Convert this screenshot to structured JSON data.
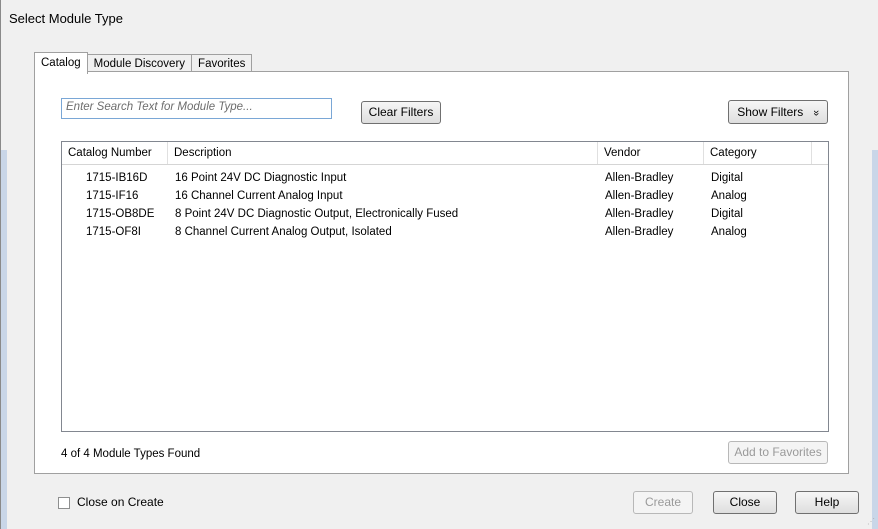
{
  "window": {
    "title": "Select Module Type"
  },
  "tabs": [
    {
      "label": "Catalog",
      "active": true
    },
    {
      "label": "Module Discovery",
      "active": false
    },
    {
      "label": "Favorites",
      "active": false
    }
  ],
  "search": {
    "placeholder": "Enter Search Text for Module Type..."
  },
  "buttons": {
    "clear_filters": "Clear Filters",
    "show_filters": "Show Filters",
    "show_filters_icon": "»",
    "add_to_favorites": "Add to Favorites",
    "create": "Create",
    "close": "Close",
    "help": "Help"
  },
  "table": {
    "columns": [
      "Catalog Number",
      "Description",
      "Vendor",
      "Category"
    ],
    "rows": [
      [
        "1715-IB16D",
        "16 Point 24V DC Diagnostic Input",
        "Allen-Bradley",
        "Digital"
      ],
      [
        "1715-IF16",
        "16 Channel Current Analog Input",
        "Allen-Bradley",
        "Analog"
      ],
      [
        "1715-OB8DE",
        "8 Point 24V DC Diagnostic Output, Electronically Fused",
        "Allen-Bradley",
        "Digital"
      ],
      [
        "1715-OF8I",
        "8 Channel Current Analog Output, Isolated",
        "Allen-Bradley",
        "Analog"
      ]
    ]
  },
  "status": {
    "found": "4 of 4 Module Types Found"
  },
  "footer": {
    "close_on_create": "Close on Create",
    "close_on_create_checked": false
  }
}
